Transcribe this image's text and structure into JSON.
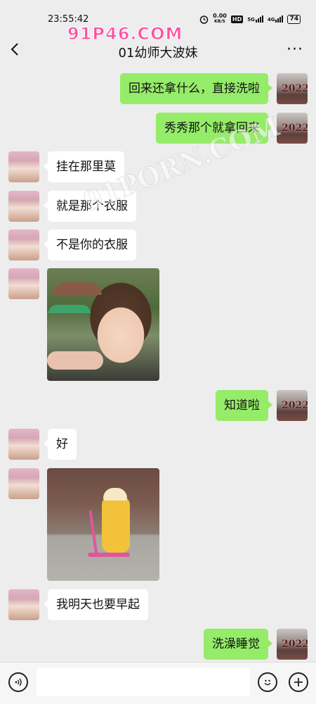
{
  "status_bar": {
    "time": "23:55:42",
    "net_speed_value": "0.00",
    "net_speed_unit": "KB/S",
    "hd_label": "HD",
    "signal1_label": "5G",
    "signal2_label": "4G",
    "battery": "74",
    "icons": [
      "alarm-icon",
      "signal-icon",
      "battery-icon"
    ]
  },
  "header": {
    "title": "01幼师大波妹",
    "back_icon": "chevron-left-icon",
    "more_label": "···"
  },
  "watermarks": {
    "top": "91P46.COM",
    "diagonal": "91PORN.COM"
  },
  "self_avatar_text": "2022",
  "messages": [
    {
      "side": "right",
      "type": "text",
      "text": "回来还拿什么，直接洗啦"
    },
    {
      "side": "right",
      "type": "text",
      "text": "秀秀那个就拿回来"
    },
    {
      "side": "left",
      "type": "text",
      "text": "挂在那里莫"
    },
    {
      "side": "left",
      "type": "text",
      "text": "就是那个衣服"
    },
    {
      "side": "left",
      "type": "text",
      "text": "不是你的衣服"
    },
    {
      "side": "left",
      "type": "image",
      "text": ""
    },
    {
      "side": "right",
      "type": "text",
      "text": "知道啦"
    },
    {
      "side": "left",
      "type": "text",
      "text": "好"
    },
    {
      "side": "left",
      "type": "image",
      "text": ""
    },
    {
      "side": "left",
      "type": "text",
      "text": "我明天也要早起"
    },
    {
      "side": "right",
      "type": "text",
      "text": "洗澡睡觉"
    }
  ],
  "input_bar": {
    "placeholder": "",
    "voice_icon": "voice-icon",
    "emoji_icon": "emoji-icon",
    "plus_icon": "plus-icon"
  },
  "colors": {
    "background": "#ededed",
    "self_bubble": "#95ec69",
    "other_bubble": "#ffffff",
    "watermark": "#ff4fa0"
  }
}
